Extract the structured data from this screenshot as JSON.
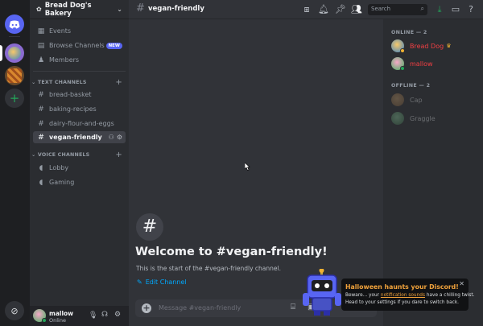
{
  "server": {
    "name": "Bread Dog's Bakery"
  },
  "sidebar": {
    "top_items": [
      {
        "label": "Events",
        "icon": "calendar-icon"
      },
      {
        "label": "Browse Channels",
        "icon": "browse-icon",
        "badge": "NEW"
      },
      {
        "label": "Members",
        "icon": "members-icon"
      }
    ],
    "text_category": "TEXT CHANNELS",
    "text_channels": [
      "bread-basket",
      "baking-recipes",
      "dairy-flour-and-eggs",
      "vegan-friendly"
    ],
    "voice_category": "VOICE CHANNELS",
    "voice_channels": [
      "Lobby",
      "Gaming"
    ]
  },
  "user": {
    "name": "mallow",
    "status": "Online"
  },
  "topbar": {
    "channel": "vegan-friendly",
    "search_placeholder": "Search"
  },
  "welcome": {
    "title": "Welcome to #vegan-friendly!",
    "subtitle": "This is the start of the #vegan-friendly channel.",
    "edit_label": "Edit Channel"
  },
  "composer": {
    "placeholder": "Message #vegan-friendly"
  },
  "members": {
    "online_header": "ONLINE — 2",
    "online": [
      {
        "name": "Bread Dog",
        "color": "#f23f43"
      },
      {
        "name": "mallow",
        "color": "#f23f43"
      }
    ],
    "offline_header": "OFFLINE — 2",
    "offline": [
      {
        "name": "Cap"
      },
      {
        "name": "Graggle"
      }
    ]
  },
  "toast": {
    "title": "Halloween haunts your Discord!",
    "line1_pre": "Beware... your ",
    "line1_link": "notification sounds",
    "line1_post": " have a chilling twist.",
    "line2": "Head to your settings if you dare to switch back."
  },
  "colors": {
    "accent": "#5865f2",
    "online": "#23a559",
    "link": "#00a8fc",
    "toast_title": "#f0a23b"
  }
}
